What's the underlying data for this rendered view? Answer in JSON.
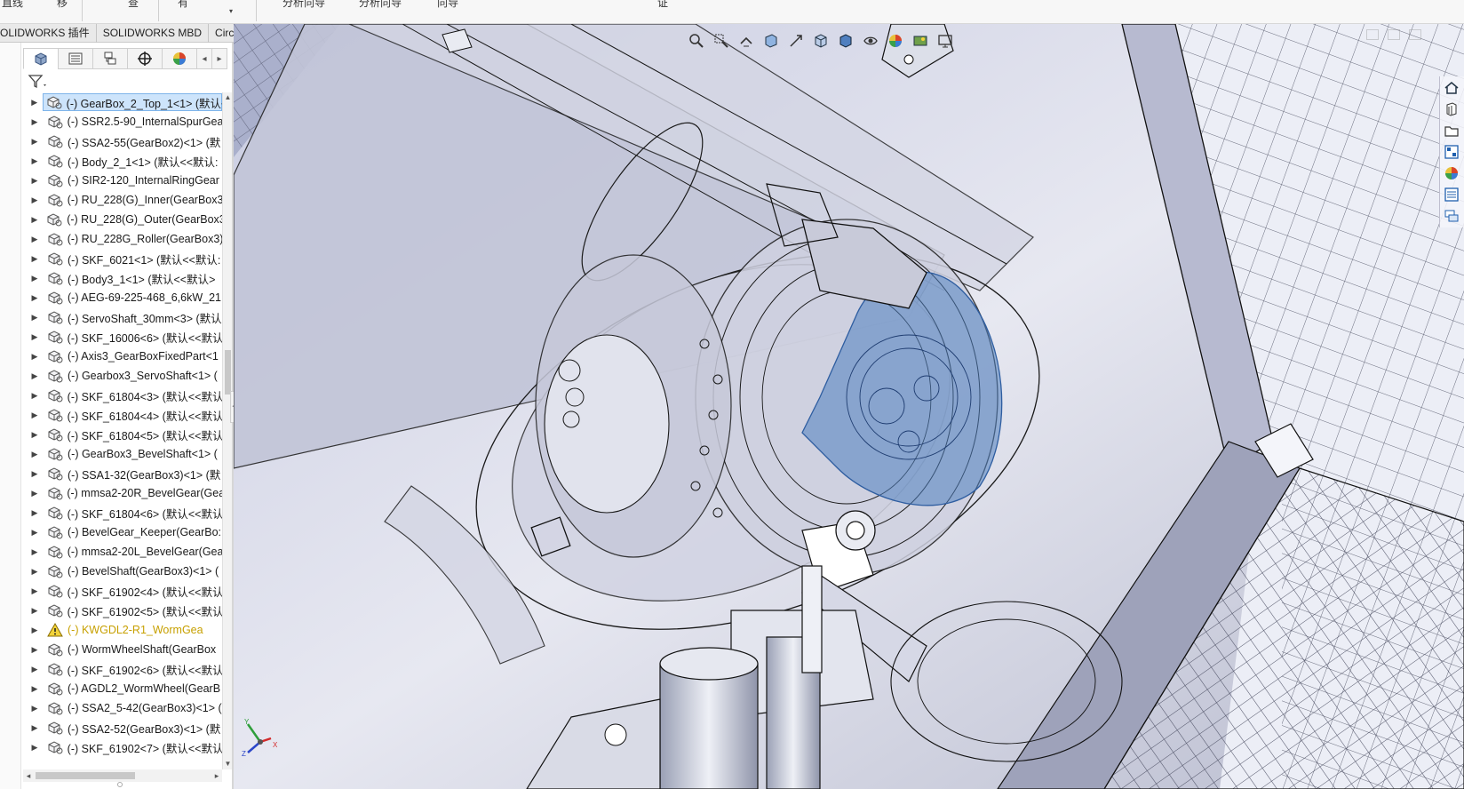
{
  "ribbon": {
    "cut_labels": [
      "直线",
      "移",
      "查",
      "有",
      "分析向导",
      "分析向导",
      "向导",
      "证"
    ]
  },
  "command_tabs": [
    "SOLIDWORKS 插件",
    "SOLIDWORKS MBD",
    "CircuitWorks"
  ],
  "feature_manager": {
    "panel_tabs": [
      "feature-manager-tree",
      "property-manager",
      "configuration-manager",
      "dimxpert-manager",
      "display-manager"
    ],
    "filter_icon": "funnel-filter-icon",
    "tree_items": [
      {
        "label": "(-) GearBox_2_Top_1<1> (默认<",
        "selected": true,
        "warning": false
      },
      {
        "label": "(-) SSR2.5-90_InternalSpurGea",
        "selected": false,
        "warning": false
      },
      {
        "label": "(-) SSA2-55(GearBox2)<1> (默",
        "selected": false,
        "warning": false
      },
      {
        "label": "(-) Body_2_1<1> (默认<<默认:",
        "selected": false,
        "warning": false
      },
      {
        "label": "(-) SIR2-120_InternalRingGear",
        "selected": false,
        "warning": false
      },
      {
        "label": "(-) RU_228(G)_Inner(GearBox3",
        "selected": false,
        "warning": false
      },
      {
        "label": "(-) RU_228(G)_Outer(GearBox3",
        "selected": false,
        "warning": false
      },
      {
        "label": "(-) RU_228G_Roller(GearBox3)",
        "selected": false,
        "warning": false
      },
      {
        "label": "(-) SKF_6021<1> (默认<<默认:",
        "selected": false,
        "warning": false
      },
      {
        "label": "(-) Body3_1<1> (默认<<默认>",
        "selected": false,
        "warning": false
      },
      {
        "label": "(-) AEG-69-225-468_6,6kW_21",
        "selected": false,
        "warning": false
      },
      {
        "label": "(-) ServoShaft_30mm<3> (默认",
        "selected": false,
        "warning": false
      },
      {
        "label": "(-) SKF_16006<6> (默认<<默认",
        "selected": false,
        "warning": false
      },
      {
        "label": "(-) Axis3_GearBoxFixedPart<1",
        "selected": false,
        "warning": false
      },
      {
        "label": "(-) Gearbox3_ServoShaft<1> (",
        "selected": false,
        "warning": false
      },
      {
        "label": "(-) SKF_61804<3> (默认<<默认",
        "selected": false,
        "warning": false
      },
      {
        "label": "(-) SKF_61804<4> (默认<<默认",
        "selected": false,
        "warning": false
      },
      {
        "label": "(-) SKF_61804<5> (默认<<默认",
        "selected": false,
        "warning": false
      },
      {
        "label": "(-) GearBox3_BevelShaft<1> (",
        "selected": false,
        "warning": false
      },
      {
        "label": "(-) SSA1-32(GearBox3)<1> (默",
        "selected": false,
        "warning": false
      },
      {
        "label": "(-) mmsa2-20R_BevelGear(Gea",
        "selected": false,
        "warning": false
      },
      {
        "label": "(-) SKF_61804<6> (默认<<默认",
        "selected": false,
        "warning": false
      },
      {
        "label": "(-) BevelGear_Keeper(GearBo:",
        "selected": false,
        "warning": false
      },
      {
        "label": "(-) mmsa2-20L_BevelGear(Gea",
        "selected": false,
        "warning": false
      },
      {
        "label": "(-) BevelShaft(GearBox3)<1> (",
        "selected": false,
        "warning": false
      },
      {
        "label": "(-) SKF_61902<4> (默认<<默认",
        "selected": false,
        "warning": false
      },
      {
        "label": "(-) SKF_61902<5> (默认<<默认",
        "selected": false,
        "warning": false
      },
      {
        "label": "(-) KWGDL2-R1_WormGea",
        "selected": false,
        "warning": true
      },
      {
        "label": "(-) WormWheelShaft(GearBox",
        "selected": false,
        "warning": false
      },
      {
        "label": "(-) SKF_61902<6> (默认<<默认",
        "selected": false,
        "warning": false
      },
      {
        "label": "(-) AGDL2_WormWheel(GearB",
        "selected": false,
        "warning": false
      },
      {
        "label": "(-) SSA2_5-42(GearBox3)<1> (",
        "selected": false,
        "warning": false
      },
      {
        "label": "(-) SSA2-52(GearBox3)<1> (默",
        "selected": false,
        "warning": false
      },
      {
        "label": "(-) SKF_61902<7> (默认<<默认",
        "selected": false,
        "warning": false
      }
    ]
  },
  "heads_up_toolbar": [
    "zoom-to-fit-icon",
    "zoom-to-area-icon",
    "previous-view-icon",
    "section-view-icon",
    "dynamic-annotation-icon",
    "view-orientation-icon",
    "display-style-icon",
    "hide-show-items-icon",
    "edit-appearance-icon",
    "apply-scene-icon",
    "view-settings-icon"
  ],
  "task_pane": [
    "solidworks-resources-icon",
    "design-library-icon",
    "file-explorer-icon",
    "view-palette-icon",
    "appearances-icon",
    "custom-properties-icon",
    "forum-icon"
  ],
  "colors": {
    "selection_fill": "#cde4fb",
    "selection_border": "#7eb4ea",
    "highlight_blue": "#4f7fbf",
    "warning_text": "#c7a000",
    "viewport_bg": "#d9dbe9"
  }
}
